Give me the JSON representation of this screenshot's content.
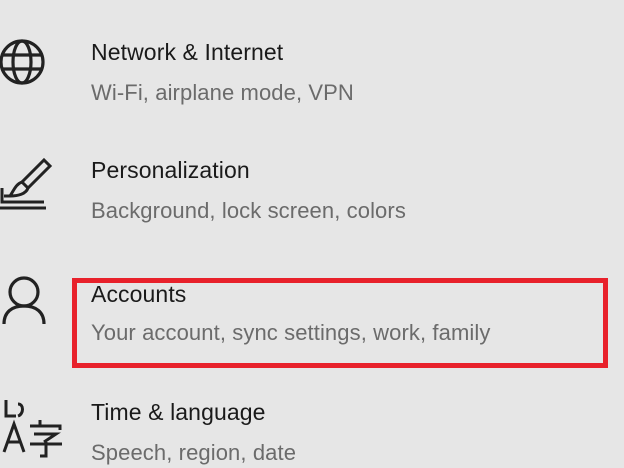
{
  "settings": {
    "items": [
      {
        "title": "Network & Internet",
        "subtitle": "Wi-Fi, airplane mode, VPN",
        "icon": "globe-icon"
      },
      {
        "title": "Personalization",
        "subtitle": "Background, lock screen, colors",
        "icon": "paintbrush-display-icon"
      },
      {
        "title": "Accounts",
        "subtitle": "Your account, sync settings, work, family",
        "icon": "person-icon"
      },
      {
        "title": "Time & language",
        "subtitle": "Speech, region, date",
        "icon": "language-icon"
      }
    ]
  },
  "highlight": {
    "color": "#e8212b",
    "target": "Accounts"
  },
  "colors": {
    "background": "#e6e6e6",
    "title": "#1a1a1a",
    "subtitle": "#6b6b6b"
  }
}
